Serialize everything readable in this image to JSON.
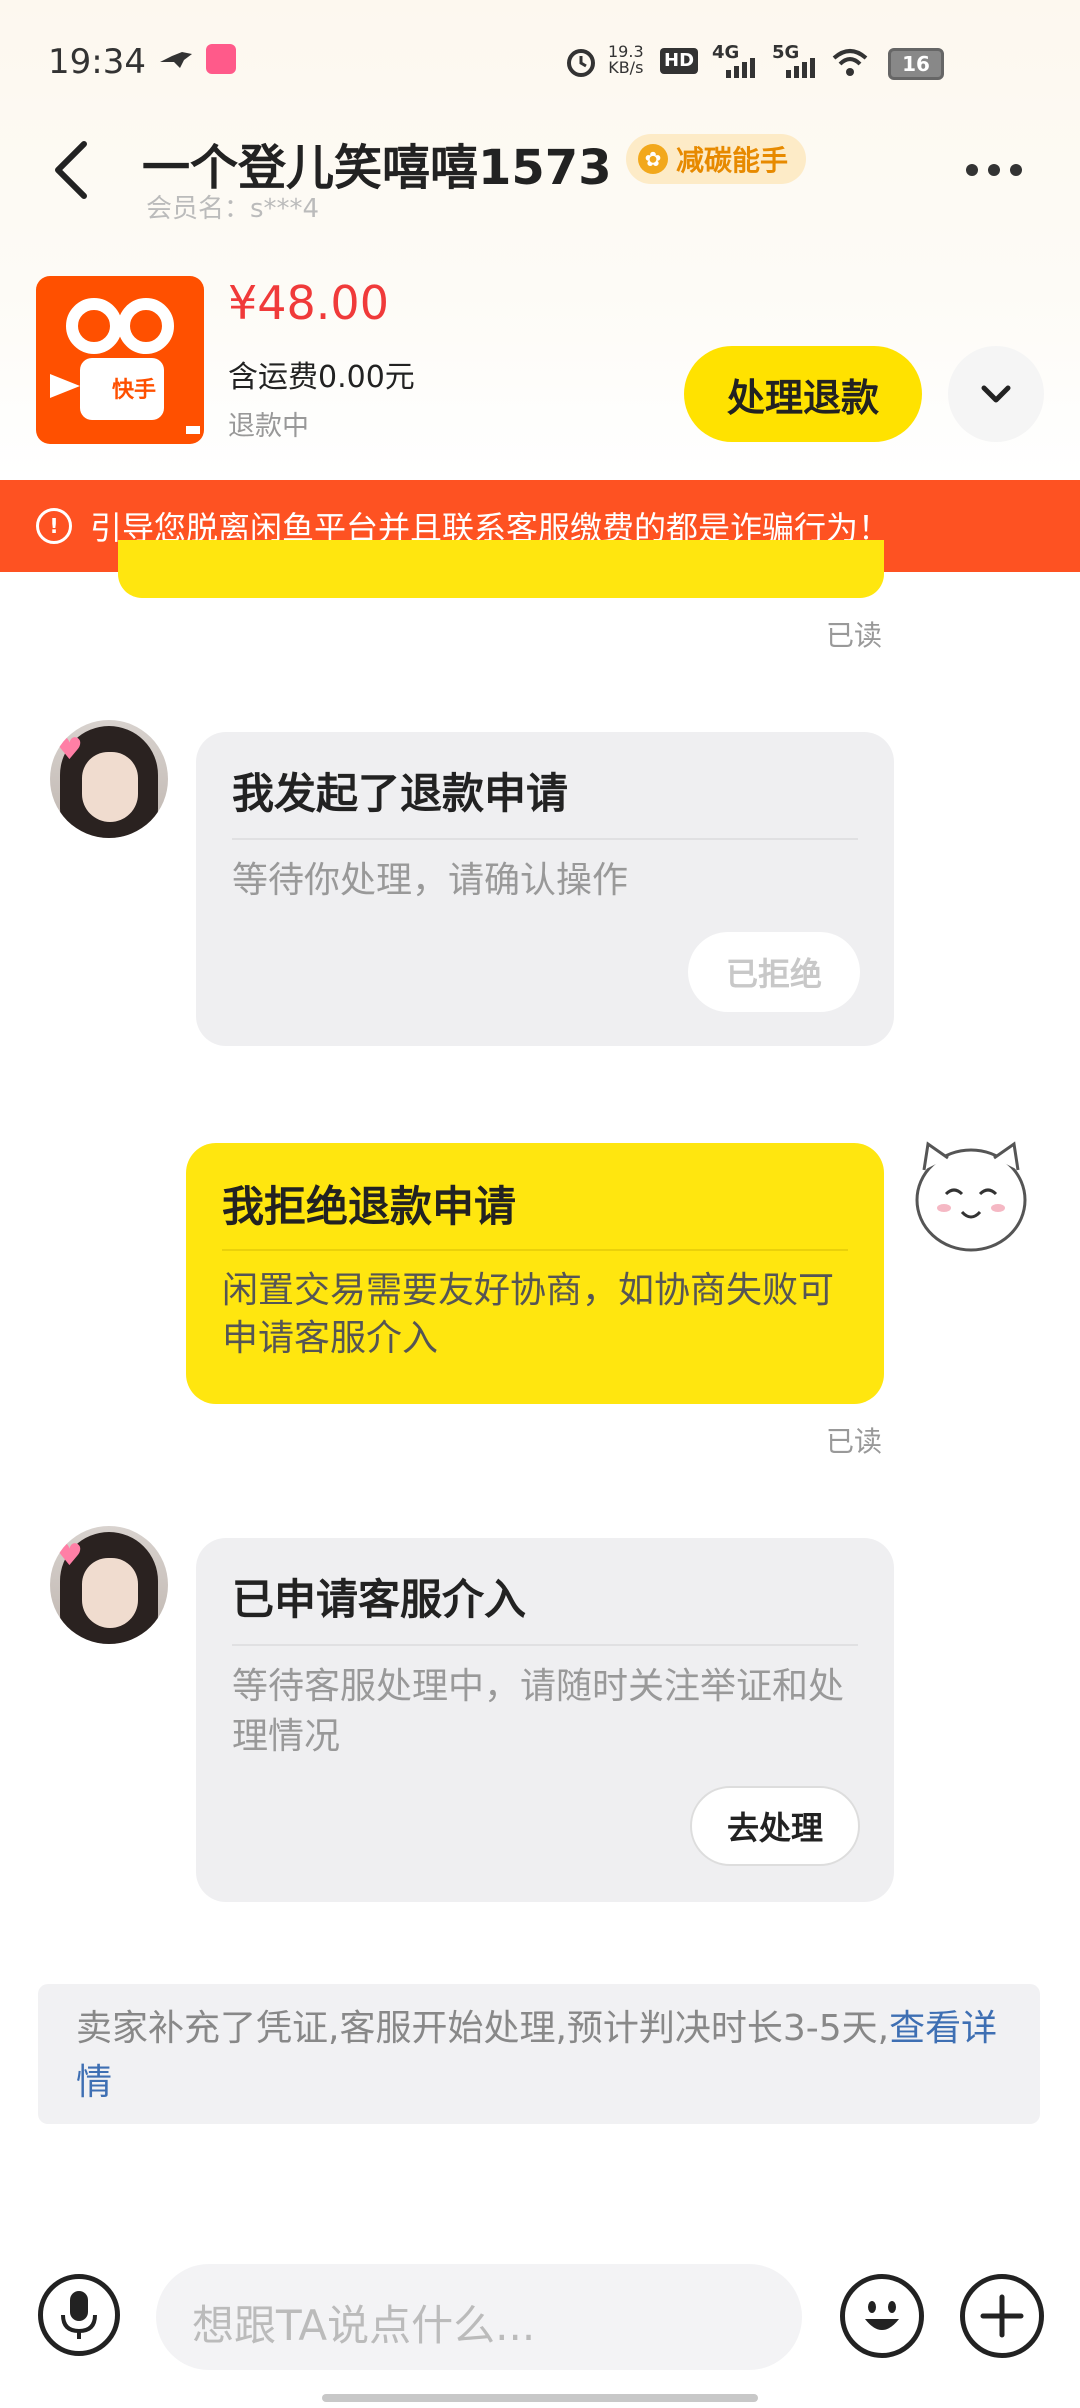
{
  "status_bar": {
    "time": "19:34",
    "net_speed": "19.3",
    "net_unit": "KB/s",
    "hd": "HD",
    "net_4g": "4G",
    "net_5g": "5G",
    "battery": "16"
  },
  "header": {
    "title": "一个登儿笑嘻嘻1573",
    "badge": "减碳能手",
    "member_label": "会员名：s***4"
  },
  "product": {
    "price": "¥48.00",
    "shipping": "含运费0.00元",
    "state": "退款中",
    "image_text": "快手",
    "action_label": "处理退款"
  },
  "warning": "引导您脱离闲鱼平台并且联系客服缴费的都是诈骗行为！",
  "messages": {
    "read_label": "已读",
    "refund_request": {
      "title": "我发起了退款申请",
      "body": "等待你处理，请确认操作",
      "button": "已拒绝"
    },
    "reject": {
      "title": "我拒绝退款申请",
      "body": "闲置交易需要友好协商，如协商失败可申请客服介入"
    },
    "service": {
      "title": "已申请客服介入",
      "body": "等待客服处理中，请随时关注举证和处理情况",
      "button": "去处理"
    }
  },
  "system_note": {
    "text": "卖家补充了凭证,客服开始处理,预计判决时长3-5天,",
    "link": "查看详情"
  },
  "input": {
    "placeholder": "想跟TA说点什么..."
  },
  "colors": {
    "accent_yellow": "#ffe60f",
    "warning_orange": "#fe5222",
    "price_red": "#f03a3a",
    "link_blue": "#3e6fb3"
  }
}
